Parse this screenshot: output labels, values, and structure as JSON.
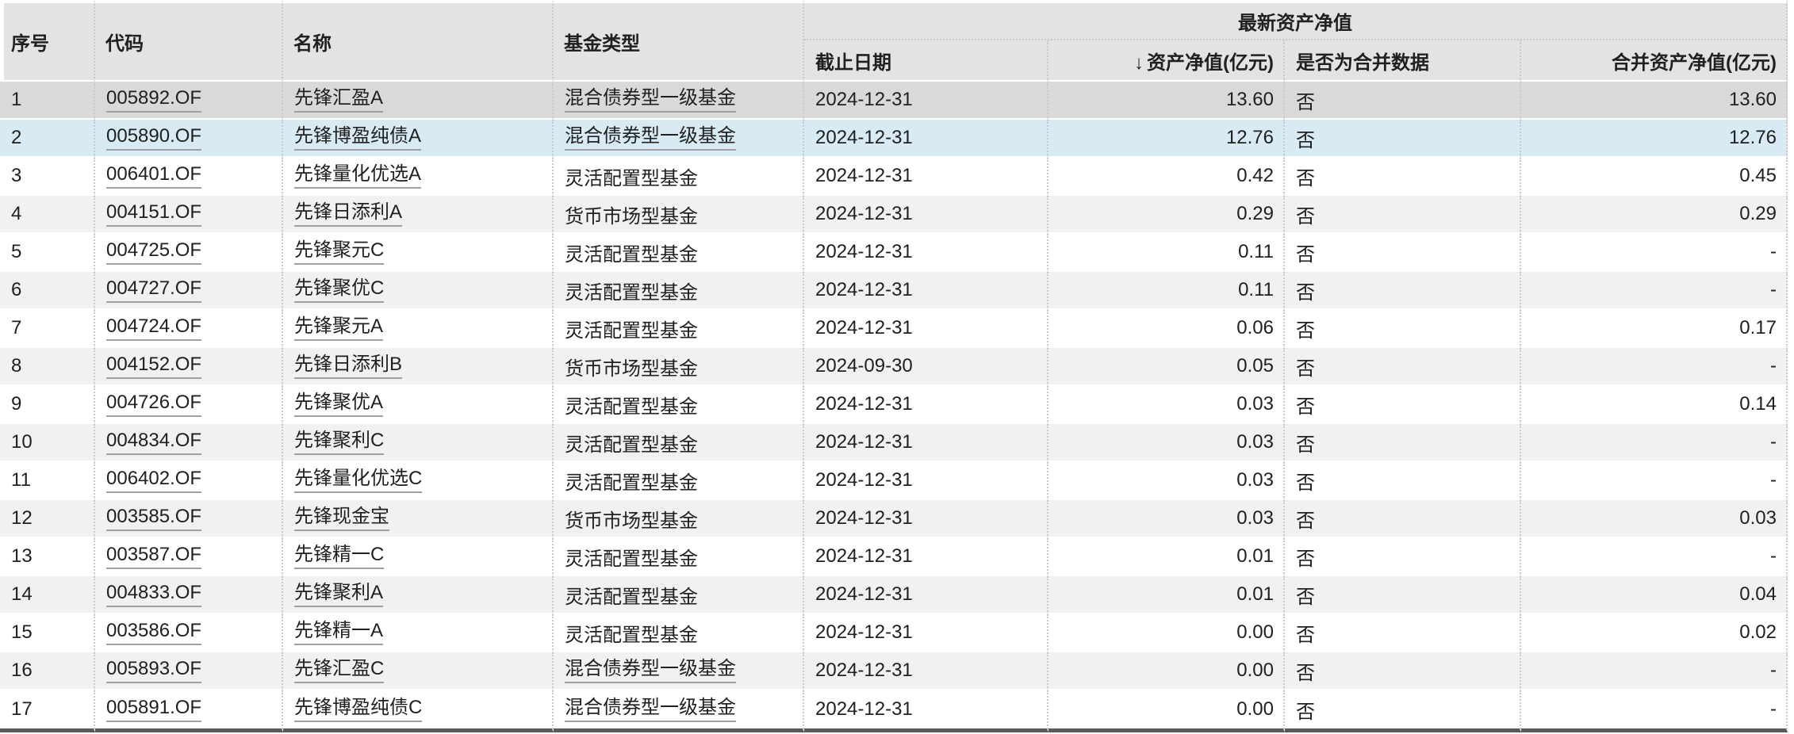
{
  "table": {
    "group_header": "最新资产净值",
    "headers": {
      "seq": "序号",
      "code": "代码",
      "name": "名称",
      "type": "基金类型",
      "end_date": "截止日期",
      "nav": "资产净值(亿元)",
      "is_merged": "是否为合并数据",
      "merged_nav": "合并资产净值(亿元)"
    },
    "sort": {
      "column": "资产净值(亿元)",
      "direction": "desc",
      "icon": "↓"
    },
    "rows": [
      {
        "seq": "1",
        "code": "005892.OF",
        "name": "先锋汇盈A",
        "type": "混合债券型一级基金",
        "type_link": true,
        "end_date": "2024-12-31",
        "nav": "13.60",
        "is_merged": "否",
        "merged_nav": "13.60",
        "state": "hover"
      },
      {
        "seq": "2",
        "code": "005890.OF",
        "name": "先锋博盈纯债A",
        "type": "混合债券型一级基金",
        "type_link": true,
        "end_date": "2024-12-31",
        "nav": "12.76",
        "is_merged": "否",
        "merged_nav": "12.76",
        "state": "selected"
      },
      {
        "seq": "3",
        "code": "006401.OF",
        "name": "先锋量化优选A",
        "type": "灵活配置型基金",
        "type_link": false,
        "end_date": "2024-12-31",
        "nav": "0.42",
        "is_merged": "否",
        "merged_nav": "0.45",
        "state": null
      },
      {
        "seq": "4",
        "code": "004151.OF",
        "name": "先锋日添利A",
        "type": "货币市场型基金",
        "type_link": false,
        "end_date": "2024-12-31",
        "nav": "0.29",
        "is_merged": "否",
        "merged_nav": "0.29",
        "state": null
      },
      {
        "seq": "5",
        "code": "004725.OF",
        "name": "先锋聚元C",
        "type": "灵活配置型基金",
        "type_link": false,
        "end_date": "2024-12-31",
        "nav": "0.11",
        "is_merged": "否",
        "merged_nav": "-",
        "state": null
      },
      {
        "seq": "6",
        "code": "004727.OF",
        "name": "先锋聚优C",
        "type": "灵活配置型基金",
        "type_link": false,
        "end_date": "2024-12-31",
        "nav": "0.11",
        "is_merged": "否",
        "merged_nav": "-",
        "state": null
      },
      {
        "seq": "7",
        "code": "004724.OF",
        "name": "先锋聚元A",
        "type": "灵活配置型基金",
        "type_link": false,
        "end_date": "2024-12-31",
        "nav": "0.06",
        "is_merged": "否",
        "merged_nav": "0.17",
        "state": null
      },
      {
        "seq": "8",
        "code": "004152.OF",
        "name": "先锋日添利B",
        "type": "货币市场型基金",
        "type_link": false,
        "end_date": "2024-09-30",
        "nav": "0.05",
        "is_merged": "否",
        "merged_nav": "-",
        "state": null
      },
      {
        "seq": "9",
        "code": "004726.OF",
        "name": "先锋聚优A",
        "type": "灵活配置型基金",
        "type_link": false,
        "end_date": "2024-12-31",
        "nav": "0.03",
        "is_merged": "否",
        "merged_nav": "0.14",
        "state": null
      },
      {
        "seq": "10",
        "code": "004834.OF",
        "name": "先锋聚利C",
        "type": "灵活配置型基金",
        "type_link": false,
        "end_date": "2024-12-31",
        "nav": "0.03",
        "is_merged": "否",
        "merged_nav": "-",
        "state": null
      },
      {
        "seq": "11",
        "code": "006402.OF",
        "name": "先锋量化优选C",
        "type": "灵活配置型基金",
        "type_link": false,
        "end_date": "2024-12-31",
        "nav": "0.03",
        "is_merged": "否",
        "merged_nav": "-",
        "state": null
      },
      {
        "seq": "12",
        "code": "003585.OF",
        "name": "先锋现金宝",
        "type": "货币市场型基金",
        "type_link": false,
        "end_date": "2024-12-31",
        "nav": "0.03",
        "is_merged": "否",
        "merged_nav": "0.03",
        "state": null
      },
      {
        "seq": "13",
        "code": "003587.OF",
        "name": "先锋精一C",
        "type": "灵活配置型基金",
        "type_link": false,
        "end_date": "2024-12-31",
        "nav": "0.01",
        "is_merged": "否",
        "merged_nav": "-",
        "state": null
      },
      {
        "seq": "14",
        "code": "004833.OF",
        "name": "先锋聚利A",
        "type": "灵活配置型基金",
        "type_link": false,
        "end_date": "2024-12-31",
        "nav": "0.01",
        "is_merged": "否",
        "merged_nav": "0.04",
        "state": null
      },
      {
        "seq": "15",
        "code": "003586.OF",
        "name": "先锋精一A",
        "type": "灵活配置型基金",
        "type_link": false,
        "end_date": "2024-12-31",
        "nav": "0.00",
        "is_merged": "否",
        "merged_nav": "0.02",
        "state": null
      },
      {
        "seq": "16",
        "code": "005893.OF",
        "name": "先锋汇盈C",
        "type": "混合债券型一级基金",
        "type_link": true,
        "end_date": "2024-12-31",
        "nav": "0.00",
        "is_merged": "否",
        "merged_nav": "-",
        "state": null
      },
      {
        "seq": "17",
        "code": "005891.OF",
        "name": "先锋博盈纯债C",
        "type": "混合债券型一级基金",
        "type_link": true,
        "end_date": "2024-12-31",
        "nav": "0.00",
        "is_merged": "否",
        "merged_nav": "-",
        "state": null
      }
    ]
  },
  "colors": {
    "header_bg": "#e3e3e3",
    "row_hover_bg": "#d9d9d9",
    "row_selected_bg": "#d8ebf4",
    "zebra_bg": "#f0f1f0",
    "divider": "#c9c9c9",
    "link_underline": "#9f9f9f",
    "bottom_border": "#5a5a5a",
    "text": "#202020"
  }
}
